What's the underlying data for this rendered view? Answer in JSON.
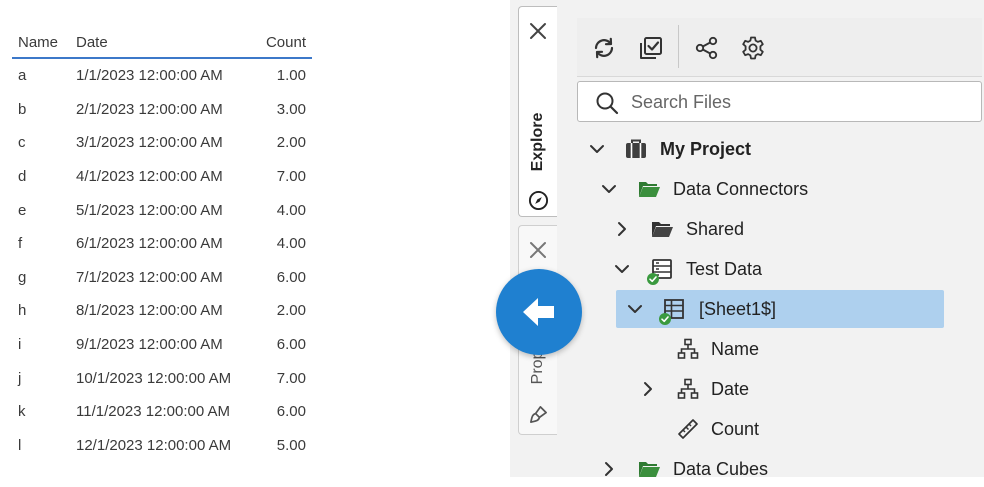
{
  "table": {
    "headers": [
      "Name",
      "Date",
      "Count"
    ],
    "rows": [
      [
        "a",
        "1/1/2023 12:00:00 AM",
        "1.00"
      ],
      [
        "b",
        "2/1/2023 12:00:00 AM",
        "3.00"
      ],
      [
        "c",
        "3/1/2023 12:00:00 AM",
        "2.00"
      ],
      [
        "d",
        "4/1/2023 12:00:00 AM",
        "7.00"
      ],
      [
        "e",
        "5/1/2023 12:00:00 AM",
        "4.00"
      ],
      [
        "f",
        "6/1/2023 12:00:00 AM",
        "4.00"
      ],
      [
        "g",
        "7/1/2023 12:00:00 AM",
        "6.00"
      ],
      [
        "h",
        "8/1/2023 12:00:00 AM",
        "2.00"
      ],
      [
        "i",
        "9/1/2023 12:00:00 AM",
        "6.00"
      ],
      [
        "j",
        "10/1/2023 12:00:00 AM",
        "7.00"
      ],
      [
        "k",
        "11/1/2023 12:00:00 AM",
        "6.00"
      ],
      [
        "l",
        "12/1/2023 12:00:00 AM",
        "5.00"
      ]
    ]
  },
  "tabs": {
    "explore": {
      "label": "Explore",
      "icon": "compass-icon",
      "close_icon": "close-icon"
    },
    "properties": {
      "label": "Prope",
      "icon": "brush-icon",
      "close_icon": "close-icon"
    }
  },
  "fab": {
    "icon": "arrow-left-icon"
  },
  "toolbar": {
    "icons": [
      "refresh-icon",
      "check-square-icon",
      "share-nodes-icon",
      "gear-icon"
    ]
  },
  "search": {
    "placeholder": "Search Files",
    "value": ""
  },
  "tree": {
    "project": "My Project",
    "data_connectors": "Data Connectors",
    "shared": "Shared",
    "test_data": "Test Data",
    "sheet": "[Sheet1$]",
    "field_name": "Name",
    "field_date": "Date",
    "field_count": "Count",
    "data_cubes": "Data Cubes"
  },
  "colors": {
    "accent": "#1f80d0",
    "table_header_line": "#3c78c9",
    "folder_green": "#3b8f3d",
    "selected_row": "#aed0ee",
    "panel_bg": "#f2f2f2",
    "check_badge": "#3a9a3f"
  }
}
